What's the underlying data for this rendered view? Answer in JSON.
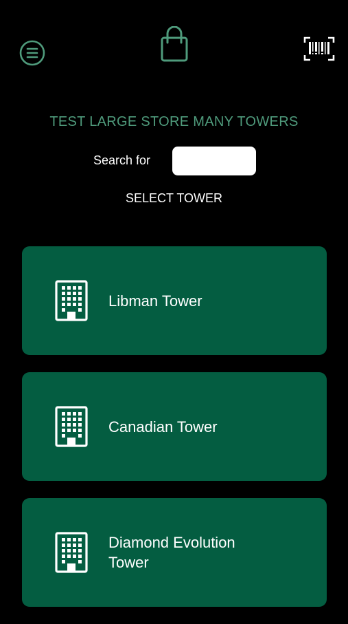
{
  "colors": {
    "background": "#000000",
    "accent": "#4f9b7c",
    "card": "#045d41",
    "text": "#ffffff"
  },
  "header": {
    "menu_icon": "hamburger-circle-icon",
    "center_icon": "shopping-bag-icon",
    "scan_icon": "barcode-scan-icon"
  },
  "store": {
    "title": "TEST LARGE STORE MANY TOWERS"
  },
  "search": {
    "label": "Search for",
    "value": "",
    "placeholder": ""
  },
  "select_heading": "SELECT TOWER",
  "towers": [
    {
      "name": "Libman Tower",
      "icon": "building-icon"
    },
    {
      "name": "Canadian Tower",
      "icon": "building-icon"
    },
    {
      "name": "Diamond Evolution Tower",
      "icon": "building-icon"
    }
  ]
}
